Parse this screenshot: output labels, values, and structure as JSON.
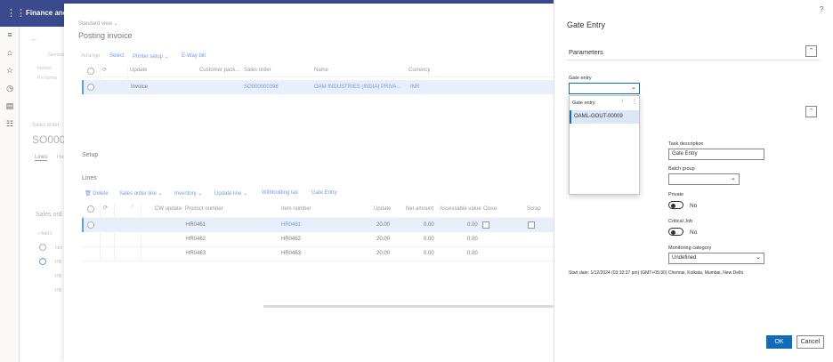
{
  "app": {
    "name": "Finance and"
  },
  "background": {
    "generic_label": "General",
    "invoice": "Invoice",
    "proforma": "Pro forma",
    "sales_order_label": "Sales order",
    "so_id": "SO000",
    "lines_tab": "Lines",
    "he_tab": "He",
    "sales_order_section": "Sales ord",
    "add_line": "+ Add li",
    "item_a": "Iten",
    "item_b": "HR",
    "item_c": "HR",
    "item_d": "HR"
  },
  "dialog": {
    "view": "Standard view",
    "title": "Posting invoice",
    "toolbar": [
      "Arrange",
      "Select",
      "Printer setup",
      "E-Way bill"
    ],
    "table1": {
      "headers": [
        "Update",
        "Customer pack...",
        "Sales order",
        "Name",
        "Currency"
      ],
      "rows": [
        [
          "Invoice",
          "",
          "SO000000398",
          "OAM INDUSTRIES (INDIA) PRIVA...",
          "INR"
        ]
      ]
    },
    "setup_label": "Setup",
    "lines_label": "Lines",
    "lines_toolbar": [
      "Delete",
      "Sales order line",
      "Inventory",
      "Update line",
      "Withholding tax",
      "Gate Entry"
    ],
    "lines_table": {
      "headers": [
        "CW update",
        "Product number",
        "Item number",
        "Update",
        "Net amount",
        "Assessable value",
        "Close",
        "Scrap"
      ],
      "rows": [
        {
          "product": "HR0461",
          "item": "HR0461",
          "update": "20.00",
          "net": "0.00",
          "assess": "0.00"
        },
        {
          "product": "HR0462",
          "item": "HR0462",
          "update": "20.00",
          "net": "0.00",
          "assess": "0.00"
        },
        {
          "product": "HR0463",
          "item": "HR0463",
          "update": "20.00",
          "net": "0.00",
          "assess": "0.00"
        }
      ]
    }
  },
  "panel": {
    "help": "?",
    "title": "Gate Entry",
    "parameters": "Parameters",
    "gate_entry_label": "Gate entry",
    "gate_entry_value": "",
    "dropdown": {
      "header": "Gate entry",
      "options": [
        "OAML-GOUT-00009"
      ]
    },
    "task_description_label": "Task description",
    "task_description_value": "Gate Entry",
    "batch_group_label": "Batch group",
    "batch_group_value": "",
    "private_label": "Private",
    "private_value": "No",
    "critical_job_label": "Critical Job",
    "critical_job_value": "No",
    "monitoring_label": "Monitoring category",
    "monitoring_value": "Undefined",
    "start_date": "Start date: 1/12/2024 (03:10:37 pm) (GMT+05:30) Chennai, Kolkata, Mumbai, New Delhi",
    "ok": "OK",
    "cancel": "Cancel"
  },
  "colors": {
    "topbar": "#3b4a8f",
    "accent": "#0f6cbd",
    "link": "#2266e3",
    "selected_row": "#dbe6f7"
  }
}
